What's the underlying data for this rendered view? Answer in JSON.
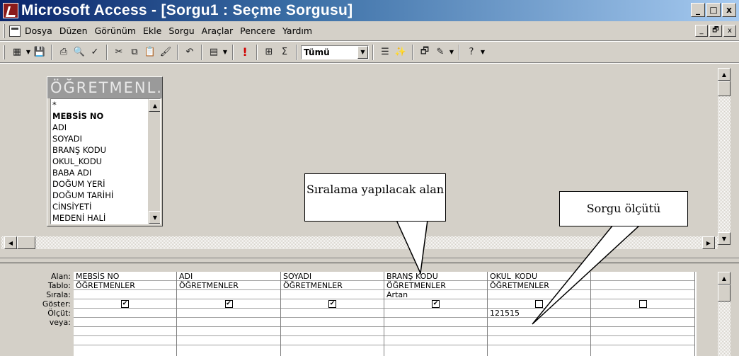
{
  "window": {
    "title": "Microsoft Access - [Sorgu1 : Seçme Sorgusu]",
    "min": "_",
    "max": "□",
    "close": "x"
  },
  "menu": {
    "items": [
      "Dosya",
      "Düzen",
      "Görünüm",
      "Ekle",
      "Sorgu",
      "Araçlar",
      "Pencere",
      "Yardım"
    ],
    "mdi_min": "_",
    "mdi_restore": "🗗",
    "mdi_close": "x"
  },
  "toolbar": {
    "top_values": "Tümü",
    "icons": [
      "view-icon",
      "save-icon",
      "print-icon",
      "print-preview-icon",
      "spelling-icon",
      "cut-icon",
      "copy-icon",
      "paste-icon",
      "format-painter-icon",
      "undo-icon",
      "query-type-icon",
      "run-icon",
      "show-table-icon",
      "totals-icon",
      "properties-icon",
      "build-icon",
      "database-window-icon",
      "new-object-icon",
      "help-icon"
    ]
  },
  "field_list": {
    "title": "ÖĞRETMENL...",
    "fields": [
      "*",
      "MEBSİS NO",
      "ADI",
      "SOYADI",
      "BRANŞ KODU",
      "OKUL_KODU",
      "BABA ADI",
      "DOĞUM YERİ",
      "DOĞUM TARİHİ",
      "CİNSİYETİ",
      "MEDENİ HALİ"
    ]
  },
  "callouts": {
    "sort": "Sıralama yapılacak alan",
    "criteria": "Sorgu ölçütü"
  },
  "grid": {
    "row_labels": [
      "Alan:",
      "Tablo:",
      "Sırala:",
      "Göster:",
      "Ölçüt:",
      "veya:"
    ],
    "columns": [
      {
        "field": "MEBSİS NO",
        "table": "ÖĞRETMENLER",
        "sort": "",
        "show": true,
        "criteria": ""
      },
      {
        "field": "ADI",
        "table": "ÖĞRETMENLER",
        "sort": "",
        "show": true,
        "criteria": ""
      },
      {
        "field": "SOYADI",
        "table": "ÖĞRETMENLER",
        "sort": "",
        "show": true,
        "criteria": ""
      },
      {
        "field": "BRANŞ KODU",
        "table": "ÖĞRETMENLER",
        "sort": "Artan",
        "show": true,
        "criteria": ""
      },
      {
        "field": "OKUL_KODU",
        "table": "ÖĞRETMENLER",
        "sort": "",
        "show": false,
        "criteria": "121515"
      },
      {
        "field": "",
        "table": "",
        "sort": "",
        "show": false,
        "criteria": ""
      }
    ]
  }
}
